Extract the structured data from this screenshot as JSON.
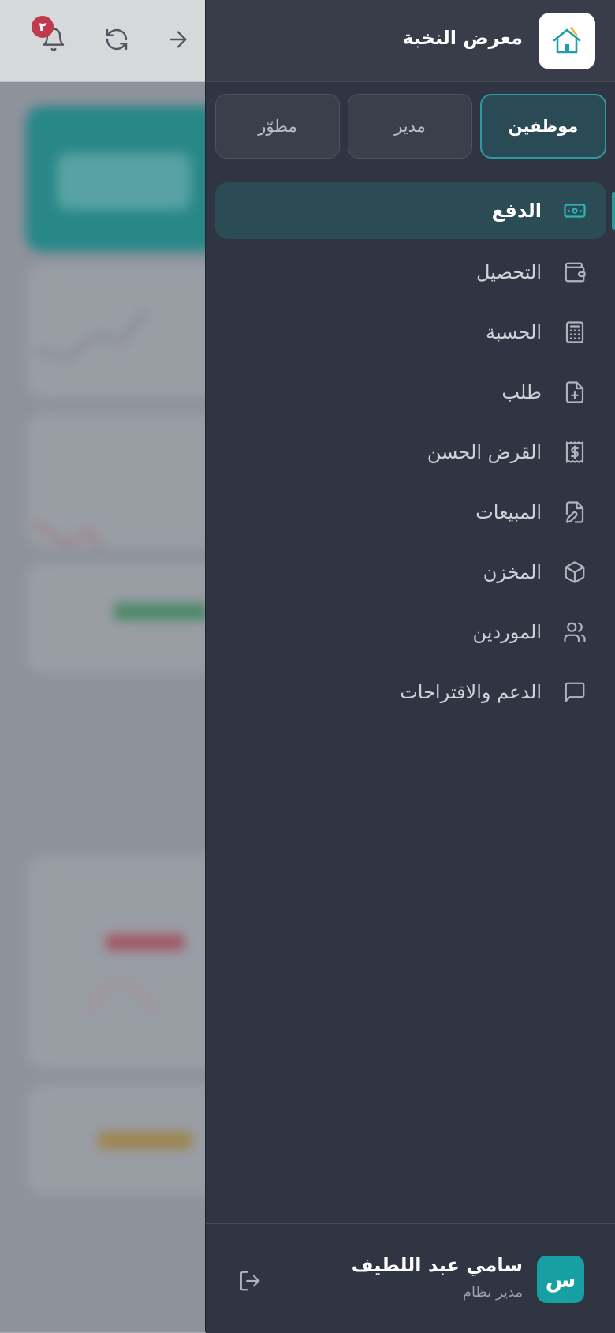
{
  "topbar": {
    "notification_count": "٢",
    "icons": [
      "bell-icon",
      "refresh-icon",
      "arrow-right-icon"
    ]
  },
  "drawer": {
    "brand": "معرض النخبة",
    "tabs": [
      {
        "label": "موظفين",
        "active": true
      },
      {
        "label": "مدير",
        "active": false
      },
      {
        "label": "مطوّر",
        "active": false
      }
    ],
    "menu": [
      {
        "label": "الدفع",
        "icon": "cash-icon",
        "active": true
      },
      {
        "label": "التحصيل",
        "icon": "wallet-icon",
        "active": false
      },
      {
        "label": "الحسبة",
        "icon": "calculator-icon",
        "active": false
      },
      {
        "label": "طلب",
        "icon": "file-plus-icon",
        "active": false
      },
      {
        "label": "القرض الحسن",
        "icon": "receipt-dollar-icon",
        "active": false
      },
      {
        "label": "المبيعات",
        "icon": "file-edit-icon",
        "active": false
      },
      {
        "label": "المخزن",
        "icon": "box-icon",
        "active": false
      },
      {
        "label": "الموردين",
        "icon": "users-icon",
        "active": false
      },
      {
        "label": "الدعم والاقتراحات",
        "icon": "message-icon",
        "active": false
      }
    ],
    "user": {
      "initial": "س",
      "name": "سامي عبد اللطيف",
      "role": "مدير نظام"
    }
  },
  "colors": {
    "accent": "#2a9aa1",
    "drawer_bg": "#303543",
    "badge": "#c0394d"
  }
}
